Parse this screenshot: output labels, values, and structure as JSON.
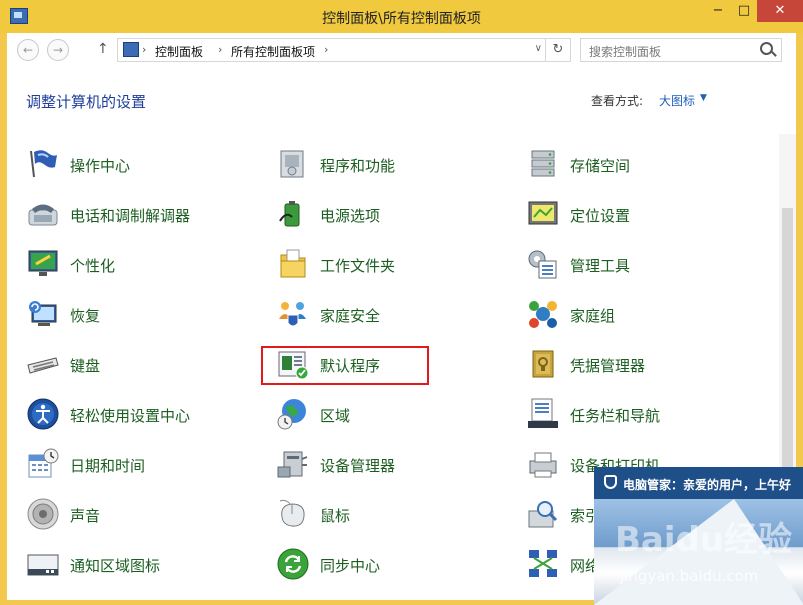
{
  "window": {
    "title": "控制面板\\所有控制面板项",
    "min": "−",
    "max": "□",
    "close": "✕"
  },
  "nav": {
    "back": "←",
    "forward": "→",
    "up": "↑",
    "breadcrumb": [
      "控制面板",
      "所有控制面板项"
    ],
    "sep": "›",
    "dropdown": "∨",
    "refresh": "↻",
    "search_placeholder": "搜索控制面板"
  },
  "header": {
    "title": "调整计算机的设置",
    "view_label": "查看方式:",
    "view_value": "大图标",
    "view_arrow": "▼"
  },
  "items": [
    {
      "label": "操作中心",
      "icon": "action-center-icon"
    },
    {
      "label": "程序和功能",
      "icon": "programs-features-icon"
    },
    {
      "label": "存储空间",
      "icon": "storage-spaces-icon"
    },
    {
      "label": "电话和调制解调器",
      "icon": "phone-modem-icon"
    },
    {
      "label": "电源选项",
      "icon": "power-options-icon"
    },
    {
      "label": "定位设置",
      "icon": "location-settings-icon"
    },
    {
      "label": "个性化",
      "icon": "personalization-icon"
    },
    {
      "label": "工作文件夹",
      "icon": "work-folders-icon"
    },
    {
      "label": "管理工具",
      "icon": "admin-tools-icon"
    },
    {
      "label": "恢复",
      "icon": "recovery-icon"
    },
    {
      "label": "家庭安全",
      "icon": "family-safety-icon"
    },
    {
      "label": "家庭组",
      "icon": "homegroup-icon"
    },
    {
      "label": "键盘",
      "icon": "keyboard-icon"
    },
    {
      "label": "默认程序",
      "icon": "default-programs-icon"
    },
    {
      "label": "凭据管理器",
      "icon": "credential-manager-icon"
    },
    {
      "label": "轻松使用设置中心",
      "icon": "ease-of-access-icon"
    },
    {
      "label": "区域",
      "icon": "region-icon"
    },
    {
      "label": "任务栏和导航",
      "icon": "taskbar-navigation-icon"
    },
    {
      "label": "日期和时间",
      "icon": "date-time-icon"
    },
    {
      "label": "设备管理器",
      "icon": "device-manager-icon"
    },
    {
      "label": "设备和打印机",
      "icon": "devices-printers-icon"
    },
    {
      "label": "声音",
      "icon": "sound-icon"
    },
    {
      "label": "鼠标",
      "icon": "mouse-icon"
    },
    {
      "label": "索引选项",
      "icon": "indexing-icon"
    },
    {
      "label": "通知区域图标",
      "icon": "notification-icons-icon"
    },
    {
      "label": "同步中心",
      "icon": "sync-center-icon"
    },
    {
      "label": "网络和共享中心",
      "icon": "network-sharing-icon"
    }
  ],
  "popup": {
    "title": "电脑管家：亲爱的用户，上午好"
  },
  "watermark": {
    "main": "Baidu经验",
    "sub": "jingyan.baidu.com"
  }
}
